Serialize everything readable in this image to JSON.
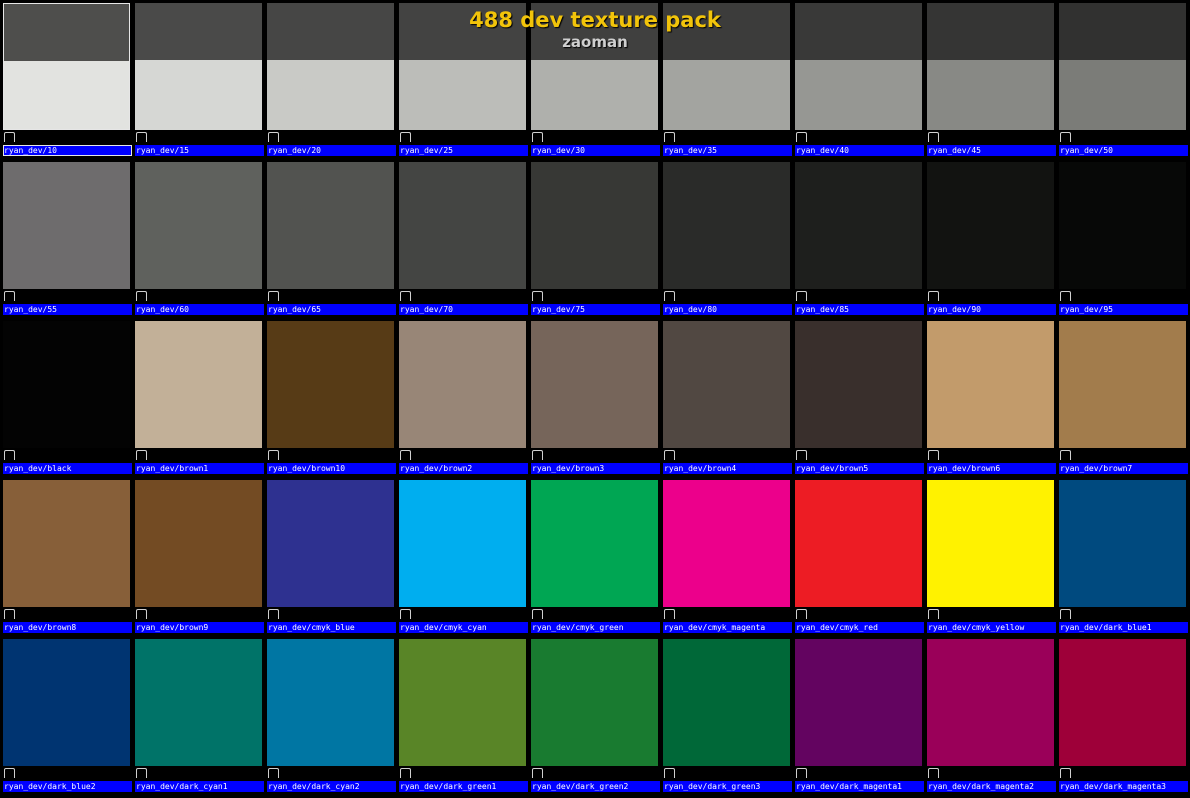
{
  "header": {
    "title": "488 dev texture pack",
    "subtitle": "zaoman"
  },
  "textures": [
    {
      "name": "ryan_dev/10",
      "top": "#4e4e4c",
      "bottom": "#e2e3e0",
      "selected": true
    },
    {
      "name": "ryan_dev/15",
      "top": "#4a4a49",
      "bottom": "#d6d7d4"
    },
    {
      "name": "ryan_dev/20",
      "top": "#464645",
      "bottom": "#c9cac6"
    },
    {
      "name": "ryan_dev/25",
      "top": "#434342",
      "bottom": "#bcbdb9"
    },
    {
      "name": "ryan_dev/30",
      "top": "#40403f",
      "bottom": "#afb0ac"
    },
    {
      "name": "ryan_dev/35",
      "top": "#3c3c3b",
      "bottom": "#a3a4a0"
    },
    {
      "name": "ryan_dev/40",
      "top": "#393938",
      "bottom": "#969793"
    },
    {
      "name": "ryan_dev/45",
      "top": "#353534",
      "bottom": "#888985"
    },
    {
      "name": "ryan_dev/50",
      "top": "#313130",
      "bottom": "#7b7c78"
    },
    {
      "name": "ryan_dev/55",
      "color": "#6e6c6d"
    },
    {
      "name": "ryan_dev/60",
      "color": "#5f615d"
    },
    {
      "name": "ryan_dev/65",
      "color": "#525350"
    },
    {
      "name": "ryan_dev/70",
      "color": "#444543"
    },
    {
      "name": "ryan_dev/75",
      "color": "#373835"
    },
    {
      "name": "ryan_dev/80",
      "color": "#2a2b29"
    },
    {
      "name": "ryan_dev/85",
      "color": "#1e1f1d"
    },
    {
      "name": "ryan_dev/90",
      "color": "#121311"
    },
    {
      "name": "ryan_dev/95",
      "color": "#070807"
    },
    {
      "name": "ryan_dev/black",
      "color": "#030303"
    },
    {
      "name": "ryan_dev/brown1",
      "color": "#c2b098"
    },
    {
      "name": "ryan_dev/brown10",
      "color": "#573b16"
    },
    {
      "name": "ryan_dev/brown2",
      "color": "#988677"
    },
    {
      "name": "ryan_dev/brown3",
      "color": "#76655a"
    },
    {
      "name": "ryan_dev/brown4",
      "color": "#514842"
    },
    {
      "name": "ryan_dev/brown5",
      "color": "#392f2c"
    },
    {
      "name": "ryan_dev/brown6",
      "color": "#c29b6b"
    },
    {
      "name": "ryan_dev/brown7",
      "color": "#a27c4c"
    },
    {
      "name": "ryan_dev/brown8",
      "color": "#875f39"
    },
    {
      "name": "ryan_dev/brown9",
      "color": "#734b23"
    },
    {
      "name": "ryan_dev/cmyk_blue",
      "color": "#2e3190"
    },
    {
      "name": "ryan_dev/cmyk_cyan",
      "color": "#00aeef"
    },
    {
      "name": "ryan_dev/cmyk_green",
      "color": "#00a653"
    },
    {
      "name": "ryan_dev/cmyk_magenta",
      "color": "#ec008b"
    },
    {
      "name": "ryan_dev/cmyk_red",
      "color": "#ed1c24"
    },
    {
      "name": "ryan_dev/cmyk_yellow",
      "color": "#fff200"
    },
    {
      "name": "ryan_dev/dark_blue1",
      "color": "#004a7f"
    },
    {
      "name": "ryan_dev/dark_blue2",
      "color": "#003471"
    },
    {
      "name": "ryan_dev/dark_cyan1",
      "color": "#007368"
    },
    {
      "name": "ryan_dev/dark_cyan2",
      "color": "#0076a3"
    },
    {
      "name": "ryan_dev/dark_green1",
      "color": "#598527"
    },
    {
      "name": "ryan_dev/dark_green2",
      "color": "#197b30"
    },
    {
      "name": "ryan_dev/dark_green3",
      "color": "#006838"
    },
    {
      "name": "ryan_dev/dark_magenta1",
      "color": "#630460"
    },
    {
      "name": "ryan_dev/dark_magenta2",
      "color": "#9a0059"
    },
    {
      "name": "ryan_dev/dark_magenta3",
      "color": "#9e0039"
    }
  ]
}
